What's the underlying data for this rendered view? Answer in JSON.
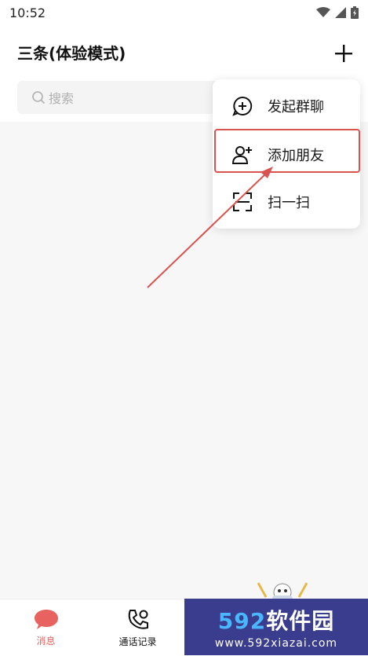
{
  "status_bar": {
    "time": "10:52"
  },
  "header": {
    "title": "三条(体验模式)"
  },
  "search": {
    "placeholder": "搜索"
  },
  "popup_menu": {
    "items": [
      {
        "label": "发起群聊",
        "icon": "chat-plus-icon"
      },
      {
        "label": "添加朋友",
        "icon": "add-user-icon"
      },
      {
        "label": "扫一扫",
        "icon": "scan-icon"
      }
    ]
  },
  "bottom_nav": {
    "items": [
      {
        "label": "消息",
        "icon": "message-bubble-icon",
        "active": true
      },
      {
        "label": "通话记录",
        "icon": "phone-call-icon",
        "active": false
      }
    ]
  },
  "watermark": {
    "brand_num": "592",
    "brand_cn": "软件园",
    "url": "www.592xiazai.com"
  },
  "colors": {
    "accent": "#e8635f",
    "annotation": "#d9534f",
    "watermark_bg": "#3a3c8e"
  }
}
